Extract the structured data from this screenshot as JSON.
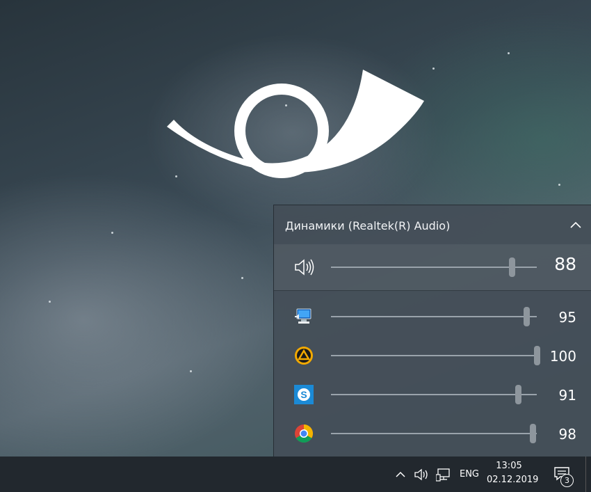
{
  "flyout": {
    "device_name": "Динамики (Realtek(R) Audio)",
    "master": {
      "icon": "speaker-icon",
      "level": 88,
      "value": "88"
    },
    "apps": [
      {
        "icon": "system-sounds-icon",
        "level": 95,
        "value": "95"
      },
      {
        "icon": "aimp-icon",
        "level": 100,
        "value": "100"
      },
      {
        "icon": "skype-icon",
        "level": 91,
        "value": "91"
      },
      {
        "icon": "chrome-icon",
        "level": 98,
        "value": "98"
      }
    ]
  },
  "taskbar": {
    "language": "ENG",
    "time": "13:05",
    "date": "02.12.2019",
    "notification_count": "3"
  },
  "colors": {
    "flyout_bg": "#444e58",
    "taskbar_bg": "#22282e",
    "slider_track": "#9aa3ab",
    "skype_blue": "#1b8ad6",
    "aimp_orange": "#f2a900"
  }
}
